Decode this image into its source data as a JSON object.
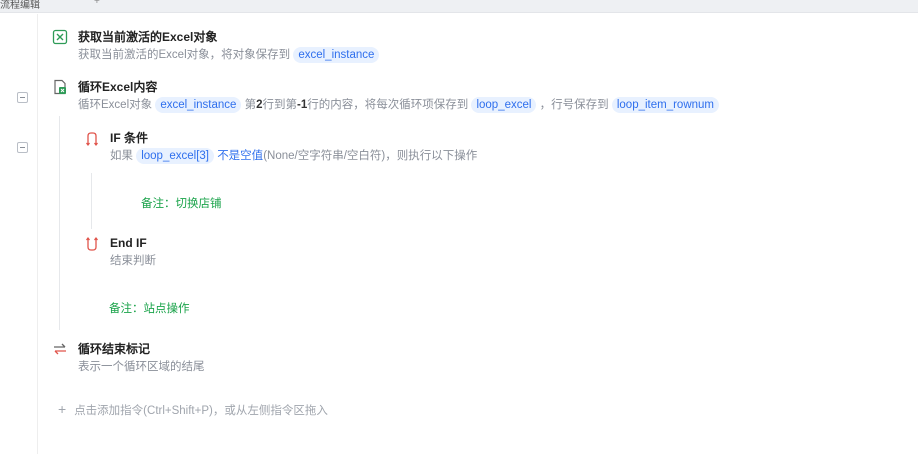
{
  "tabs": {
    "active": "流程编辑",
    "extra": "+"
  },
  "steps": [
    {
      "title": "获取当前激活的Excel对象",
      "desc_prefix": "获取当前激活的Excel对象，将对象保存到",
      "var": "excel_instance"
    },
    {
      "title": "循环Excel内容",
      "desc_prefix": "循环Excel对象",
      "var1": "excel_instance",
      "desc_mid1": "第",
      "start_row": "2",
      "desc_mid2": "行到第",
      "end_row": "-1",
      "desc_mid3": "行的内容，将每次循环项保存到",
      "var2": "loop_excel",
      "desc_mid4": "，行号保存到",
      "var3": "loop_item_rownum"
    },
    {
      "title": "IF 条件",
      "desc_prefix": "如果",
      "var": "loop_excel[3]",
      "keyword": "不是空值",
      "desc_suffix": "(None/空字符串/空白符)，则执行以下操作"
    },
    {
      "note": "备注：切换店铺"
    },
    {
      "title": "End IF",
      "desc": "结束判断"
    },
    {
      "note": "备注：站点操作"
    },
    {
      "title": "循环结束标记",
      "desc": "表示一个循环区域的结尾"
    }
  ],
  "add_hint": "点击添加指令(Ctrl+Shift+P)，或从左侧指令区拖入",
  "colors": {
    "accent": "#2f6fed",
    "var_bg": "#e8f1ff",
    "note": "#1aa34a",
    "muted": "#8a8f99"
  },
  "icons": [
    "excel-activate-icon",
    "excel-loop-icon",
    "if-branch-icon",
    "end-if-icon",
    "loop-end-icon",
    "plus-icon",
    "collapse-icon"
  ]
}
